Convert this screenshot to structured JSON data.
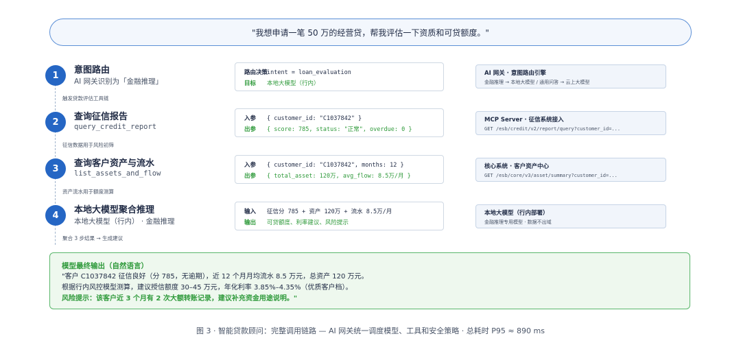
{
  "prompt": "\"我想申请一笔 50 万的经营贷，帮我评估一下资质和可贷额度。\"",
  "steps": [
    {
      "number": "1",
      "title": "意图路由",
      "subtitle": "AI 网关识别为「金融推理」",
      "note": "触发贷款评估工具链",
      "mid": [
        {
          "label": "路由决策",
          "value": "intent = loan_evaluation"
        },
        {
          "label": "目标",
          "value": "本地大模型（行内）"
        }
      ],
      "right_title": "AI 网关 · 意图路由引擎",
      "right_sub": "金融推理 → 本地大模型 / 通用问答 → 云上大模型"
    },
    {
      "number": "2",
      "title": "查询征信报告",
      "subtitle": "query_credit_report",
      "note": "征信数据用于风险初筛",
      "mid": [
        {
          "label": "入参",
          "value": "{ customer_id: \"C1037842\" }"
        },
        {
          "label": "出参",
          "value": "{ score: 785, status: \"正常\", overdue: 0 }"
        }
      ],
      "right_title": "MCP Server · 征信系统接入",
      "right_sub": "GET /esb/credit/v2/report/query?customer_id=..."
    },
    {
      "number": "3",
      "title": "查询客户资产与流水",
      "subtitle": "list_assets_and_flow",
      "note": "资产流水用于额度测算",
      "mid": [
        {
          "label": "入参",
          "value": "{ customer_id: \"C1037842\", months: 12 }"
        },
        {
          "label": "出参",
          "value": "{ total_asset: 120万, avg_flow: 8.5万/月 }"
        }
      ],
      "right_title": "核心系统 · 客户资产中心",
      "right_sub": "GET /esb/core/v3/asset/summary?customer_id=..."
    },
    {
      "number": "4",
      "title": "本地大模型聚合推理",
      "subtitle": "本地大模型（行内） · 金融推理",
      "note": "聚合 3 步结果 → 生成建议",
      "mid": [
        {
          "label": "输入",
          "value": "征信分 785 + 资产 120万 + 流水 8.5万/月"
        },
        {
          "label": "输出",
          "value": "可贷额度、利率建议、风险提示"
        }
      ],
      "right_title": "本地大模型（行内部署）",
      "right_sub": "金融推理专用模型 · 数据不出域"
    }
  ],
  "output": {
    "title": "模型最终输出（自然语言）",
    "line1": "\"客户 C1037842 征信良好（分 785，无逾期），近 12 个月月均流水 8.5 万元，总资产 120 万元。",
    "line2": "根据行内风控模型测算，建议授信额度 30–45 万元，年化利率 3.85%–4.35%（优质客户档）。",
    "line3": "风险提示：该客户近 3 个月有 2 次大额转账记录，建议补充资金用途说明。\""
  },
  "caption": "图 3 · 智能贷款顾问：完整调用链路 — AI 网关统一调度模型、工具和安全策略 · 总耗时 P95 ≈ 890 ms",
  "colors": {
    "accent_blue": "#2566c4",
    "accent_green": "#2f9a3b",
    "prompt_border": "#5b8fd6",
    "output_border": "#59b66a"
  }
}
